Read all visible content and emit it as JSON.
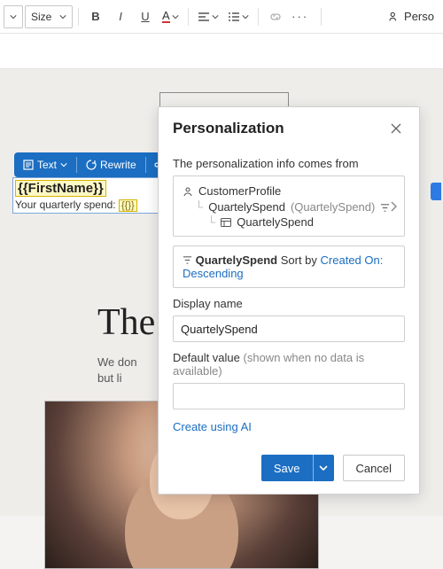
{
  "toolbar": {
    "size_label": "Size",
    "perso_label": "Perso"
  },
  "float": {
    "text": "Text",
    "rewrite": "Rewrite"
  },
  "textblock": {
    "first_token": "{{FirstName}}",
    "spend_prefix": "Your quarterly spend: ",
    "spend_token": "{{}}"
  },
  "panel": {
    "title": "Personalization",
    "source_label": "The personalization info comes from",
    "tree": {
      "root": "CustomerProfile",
      "level1": "QuartelySpend",
      "level1_paren": "(QuartelySpend)",
      "level2": "QuartelySpend"
    },
    "sort": {
      "prefix_icon_field": "QuartelySpend",
      "sort_by": "Sort by",
      "link": "Created On: Descending"
    },
    "display_name_label": "Display name",
    "display_name_value": "QuartelySpend",
    "default_label": "Default value",
    "default_hint": "(shown when no data is available)",
    "default_value": "",
    "ai_link": "Create using AI",
    "save": "Save",
    "cancel": "Cancel"
  },
  "hero": {
    "title": "The",
    "line1": "We don",
    "line2": "but li"
  }
}
